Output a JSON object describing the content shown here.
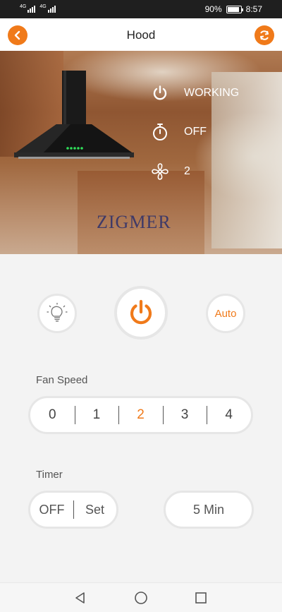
{
  "status_bar": {
    "signal_1": "4G",
    "signal_2": "4G",
    "battery_percent": "90%",
    "battery_level": 0.9,
    "time": "8:57"
  },
  "header": {
    "title": "Hood",
    "back_icon": "chevron-left-icon",
    "refresh_icon": "refresh-icon"
  },
  "hero": {
    "brand": "ZIGMER",
    "power_status": "WORKING",
    "timer_status": "OFF",
    "fan_status": "2"
  },
  "controls": {
    "light_icon": "lightbulb-icon",
    "power_icon": "power-icon",
    "auto_label": "Auto"
  },
  "fan_speed": {
    "label": "Fan Speed",
    "options": [
      "0",
      "1",
      "2",
      "3",
      "4"
    ],
    "selected": "2"
  },
  "timer": {
    "label": "Timer",
    "off_label": "OFF",
    "set_label": "Set",
    "value": "5 Min"
  },
  "colors": {
    "accent": "#f07a1a",
    "background": "#f3f3f3",
    "status_bar": "#1f1f1f"
  }
}
